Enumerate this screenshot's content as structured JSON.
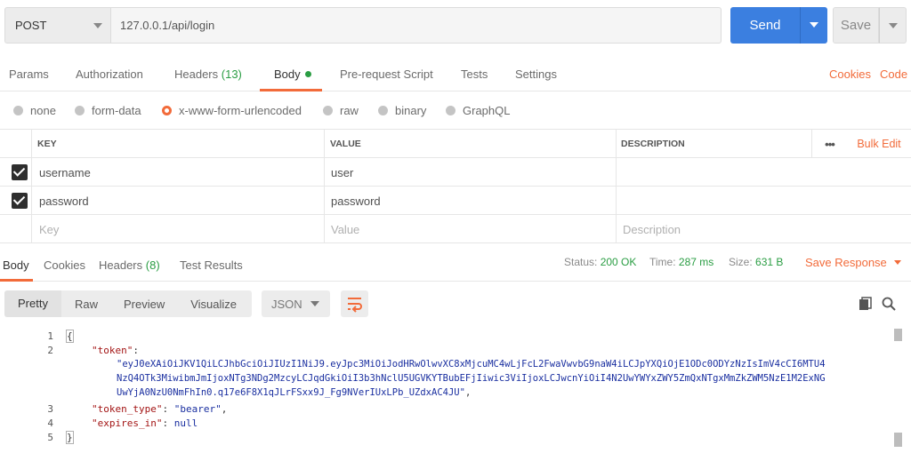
{
  "request": {
    "method": "POST",
    "url": "127.0.0.1/api/login",
    "send_label": "Send",
    "save_label": "Save"
  },
  "req_tabs": {
    "params": "Params",
    "authorization": "Authorization",
    "headers": "Headers",
    "headers_count": "(13)",
    "body": "Body",
    "pre_request": "Pre-request Script",
    "tests": "Tests",
    "settings": "Settings",
    "cookies": "Cookies",
    "code": "Code"
  },
  "body_types": {
    "none": "none",
    "form_data": "form-data",
    "urlencoded": "x-www-form-urlencoded",
    "raw": "raw",
    "binary": "binary",
    "graphql": "GraphQL",
    "selected": "x-www-form-urlencoded"
  },
  "kv_table": {
    "headers": {
      "key": "KEY",
      "value": "VALUE",
      "description": "DESCRIPTION",
      "more": "•••",
      "bulk_edit": "Bulk Edit"
    },
    "rows": [
      {
        "key": "username",
        "value": "user",
        "checked": true
      },
      {
        "key": "password",
        "value": "password",
        "checked": true
      }
    ],
    "placeholder": {
      "key": "Key",
      "value": "Value",
      "description": "Description"
    }
  },
  "response_tabs": {
    "body": "Body",
    "cookies": "Cookies",
    "headers": "Headers",
    "headers_count": "(8)",
    "test_results": "Test Results"
  },
  "response_status": {
    "status_label": "Status:",
    "status_value": "200 OK",
    "time_label": "Time:",
    "time_value": "287 ms",
    "size_label": "Size:",
    "size_value": "631 B",
    "save_response": "Save Response"
  },
  "response_toolbar": {
    "pretty": "Pretty",
    "raw": "Raw",
    "preview": "Preview",
    "visualize": "Visualize",
    "format": "JSON"
  },
  "code": {
    "line_numbers": [
      "1",
      "2",
      "3",
      "4",
      "5"
    ],
    "open_brace": "{",
    "close_brace": "}",
    "token_key": "\"token\"",
    "token_value_1": "\"eyJ0eXAiOiJKV1QiLCJhbGciOiJIUzI1NiJ9.eyJpc3MiOiJodHRwOlwvXC8xMjcuMC4wLjFcL2FwaVwvbG9naW4iLCJpYXQiOjE1ODc0ODYzNzIsImV4cCI6MTU4",
    "token_value_2": "NzQ4OTk3MiwibmJmIjoxNTg3NDg2MzcyLCJqdGkiOiI3b3hNclU5UGVKYTBubEFjIiwic3ViIjoxLCJwcnYiOiI4N2UwYWYxZWY5ZmQxNTgxMmZkZWM5NzE1M2ExNG",
    "token_value_3": "UwYjA0NzU0NmFhIn0.q17e6F8X1qJLrFSxx9J_Fg9NVerIUxLPb_UZdxAC4JU\"",
    "token_type_key": "\"token_type\"",
    "token_type_value": "\"bearer\"",
    "expires_key": "\"expires_in\"",
    "expires_value": "null"
  },
  "colors": {
    "accent": "#f26b3a",
    "send": "#3b7fe0",
    "success": "#2a9d43"
  }
}
